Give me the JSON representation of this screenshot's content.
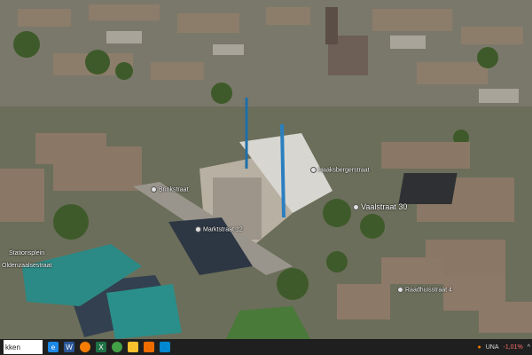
{
  "map": {
    "labels": [
      {
        "text": "Vaalstraat 30",
        "big": true
      },
      {
        "text": "Brinkstraat"
      },
      {
        "text": "Oldenzaalsestraat"
      },
      {
        "text": "Marktstraat 12"
      },
      {
        "text": "Haaksbergerstraat"
      },
      {
        "text": "Raadhuisstraat 4"
      },
      {
        "text": "Stationsplein"
      }
    ]
  },
  "taskbar": {
    "search_text": "kken",
    "apps": [
      {
        "icon": "edge-icon",
        "color": "#1e88e5"
      },
      {
        "icon": "word-icon",
        "color": "#2b5797"
      },
      {
        "icon": "firefox-icon",
        "color": "#f57c00"
      },
      {
        "icon": "excel-icon",
        "color": "#1e7145"
      },
      {
        "icon": "chrome-icon",
        "color": "#43a047"
      },
      {
        "icon": "files-icon",
        "color": "#fbc02d"
      },
      {
        "icon": "orange-app-icon",
        "color": "#ef6c00"
      },
      {
        "icon": "blue-app-icon",
        "color": "#0288d1"
      }
    ],
    "tray": {
      "currency": "UNA",
      "change": "-1,01%"
    }
  }
}
